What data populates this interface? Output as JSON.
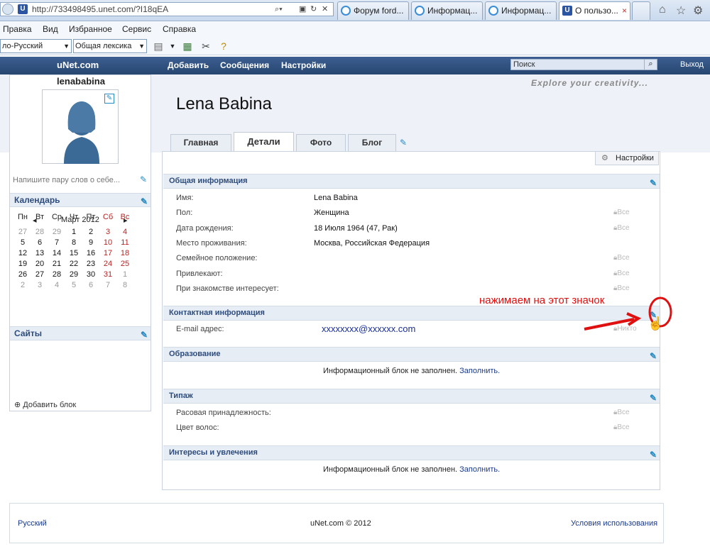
{
  "browser": {
    "url": "http://733498495.unet.com/?I18qEA",
    "favicon": "U",
    "tabs": [
      {
        "label": "Форум ford..."
      },
      {
        "label": "Информац..."
      },
      {
        "label": "Информац..."
      },
      {
        "label": "О пользо...",
        "close": "×"
      }
    ],
    "menu": [
      "Правка",
      "Вид",
      "Избранное",
      "Сервис",
      "Справка"
    ],
    "lang_select": "ло-Русский",
    "lex_select": "Общая лексика"
  },
  "site": {
    "logo": "uNet.com",
    "nav": [
      "Добавить",
      "Сообщения",
      "Настройки"
    ],
    "search_placeholder": "Поиск",
    "exit": "Выход",
    "slogan": "Explore your creativity..."
  },
  "profile": {
    "username": "lenababina",
    "name": "Lena Babina",
    "status_placeholder": "Напишите пару слов о себе...",
    "tabs": [
      "Главная",
      "Детали",
      "Фото",
      "Блог"
    ],
    "active_tab": "Детали"
  },
  "sidebar": {
    "calendar_title": "Календарь",
    "month": "Март 2012",
    "weekdays": [
      "Пн",
      "Вт",
      "Ср",
      "Чт",
      "Пт",
      "Сб",
      "Вс"
    ],
    "weeks": [
      [
        "27",
        "28",
        "29",
        "1",
        "2",
        "3",
        "4"
      ],
      [
        "5",
        "6",
        "7",
        "8",
        "9",
        "10",
        "11"
      ],
      [
        "12",
        "13",
        "14",
        "15",
        "16",
        "17",
        "18"
      ],
      [
        "19",
        "20",
        "21",
        "22",
        "23",
        "24",
        "25"
      ],
      [
        "26",
        "27",
        "28",
        "29",
        "30",
        "31",
        "1"
      ],
      [
        "2",
        "3",
        "4",
        "5",
        "6",
        "7",
        "8"
      ]
    ],
    "sites_title": "Сайты",
    "add_block": "Добавить блок"
  },
  "details": {
    "settings_btn": "Настройки",
    "general_title": "Общая информация",
    "general": [
      {
        "label": "Имя:",
        "value": "Lena Babina",
        "priv": ""
      },
      {
        "label": "Пол:",
        "value": "Женщина",
        "priv": "Все"
      },
      {
        "label": "Дата рождения:",
        "value": "18 Июля 1964 (47, Рак)",
        "priv": "Все"
      },
      {
        "label": "Место проживания:",
        "value": "Москва, Российская Федерация",
        "priv": ""
      },
      {
        "label": "Семейное положение:",
        "value": "",
        "priv": "Все"
      },
      {
        "label": "Привлекают:",
        "value": "",
        "priv": "Все"
      },
      {
        "label": "При знакомстве интересует:",
        "value": "",
        "priv": "Все"
      }
    ],
    "contact_title": "Контактная информация",
    "email_label": "E-mail адрес:",
    "email": "xxxxxxxx@xxxxxx.com",
    "email_priv": "Никто",
    "edu_title": "Образование",
    "empty_text": "Информационный блок не заполнен.",
    "fill_link": "Заполнить.",
    "type_title": "Типаж",
    "type": [
      {
        "label": "Расовая принадлежность:",
        "priv": "Все"
      },
      {
        "label": "Цвет волос:",
        "priv": "Все"
      }
    ],
    "interests_title": "Интересы и увлечения"
  },
  "annotation": "нажимаем на этот значок",
  "footer": {
    "lang": "Русский",
    "copy": "uNet.com © 2012",
    "terms": "Условия использования"
  }
}
